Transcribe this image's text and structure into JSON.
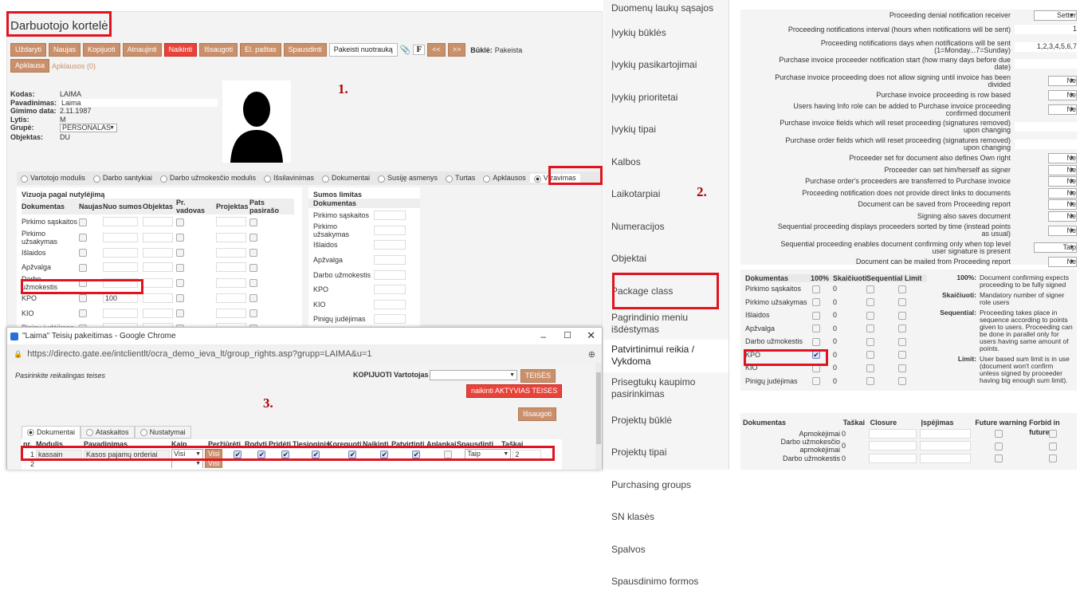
{
  "left": {
    "title": "Darbuotojo kortelė",
    "toolbar": [
      "Uždaryti",
      "Naujas",
      "Kopijuoti",
      "Atnaujinti",
      "Naikinti",
      "Išsaugoti",
      "El. paštas",
      "Spausdinti",
      "Pakeisti nuotrauką",
      "F",
      "<<",
      ">>"
    ],
    "status_label": "Būklė:",
    "status_value": "Pakeista",
    "survey_btn": "Apklausa",
    "survey_count": "Apklausos (0)",
    "fields": [
      {
        "l": "Kodas:",
        "v": "LAIMA"
      },
      {
        "l": "Pavadinimas:",
        "v": "Laima"
      },
      {
        "l": "Gimimo data:",
        "v": "2.11.1987"
      },
      {
        "l": "Lytis:",
        "v": "M"
      },
      {
        "l": "Grupė:",
        "v": "PERSONALAS"
      },
      {
        "l": "Objektas:",
        "v": "DU"
      }
    ],
    "tabs": [
      "Vartotojo modulis",
      "Darbo santykiai",
      "Darbo užmokesčio modulis",
      "Išsilavinimas",
      "Dokumentai",
      "Susiję asmenys",
      "Turtas",
      "Apklausos",
      "Vizavimas"
    ],
    "grid_title": "Vizuoja pagal nutylėjimą",
    "grid_headers": [
      "Dokumentas",
      "Naujas",
      "Nuo sumos",
      "Objektas",
      "Pr. vadovas",
      "Projektas",
      "Pats pasirašo"
    ],
    "grid_rows": [
      {
        "d": "Pirkimo sąskaitos",
        "s": ""
      },
      {
        "d": "Pirkimo užsakymas",
        "s": ""
      },
      {
        "d": "Išlaidos",
        "s": ""
      },
      {
        "d": "Apžvalga",
        "s": ""
      },
      {
        "d": "Darbo užmokestis",
        "s": ""
      },
      {
        "d": "KPO",
        "s": "100"
      },
      {
        "d": "KIO",
        "s": ""
      },
      {
        "d": "Pinigų judėjimas",
        "s": ""
      }
    ],
    "sum_title": "Sumos limitas",
    "sum_header": "Dokumentas",
    "sum_rows": [
      "Pirkimo sąskaitos",
      "Pirkimo užsakymas",
      "Išlaidos",
      "Apžvalga",
      "Darbo užmokestis",
      "KPO",
      "KIO",
      "Pinigų judėjimas"
    ]
  },
  "popup": {
    "title": "\"Laima\" Teisių pakeitimas - Google Chrome",
    "url": "https://directo.gate.ee/intclientlt/ocra_demo_ieva_lt/group_rights.asp?grupp=LAIMA&u=1",
    "label": "Pasirinkite reikalingas teises",
    "copy_label": "KOPIJUOTI Vartotojas",
    "teises": "TEISĖS",
    "delete": "naikinti AKTYVIAS TEISES",
    "save": "Išsaugoti",
    "tabs": [
      "Dokumentai",
      "Ataskaitos",
      "Nustatymai"
    ],
    "headers": [
      "nr.",
      "Modulis",
      "Pavadinimas",
      "Kaip",
      "Peržiūrėti",
      "Rodyti",
      "Pridėti",
      "Tiesioginis",
      "Koreguoti",
      "Naikinti",
      "Patvirtinti",
      "Aplankai",
      "Spausdinti",
      "Taškai"
    ],
    "row": {
      "nr": "1",
      "module": "kassain",
      "name": "Kasos pajamų orderiai",
      "kaip": "Visi",
      "visi": "Visi",
      "print": "Taip",
      "points": "2"
    },
    "row2": {
      "nr": "2",
      "visi": "Visi"
    }
  },
  "nav": [
    "Duomenų laukų sąsajos",
    "Įvykių būklės",
    "Įvykių pasikartojimai",
    "Įvykių prioritetai",
    "Įvykių tipai",
    "Kalbos",
    "Laikotarpiai",
    "Numeracijos",
    "Objektai",
    "Package class",
    "Pagrindinio meniu išdėstymas",
    "Patvirtinimui reikia / Vykdoma",
    "Prisegtukų kaupimo pasirinkimas",
    "Projektų būklė",
    "Projektų tipai",
    "Purchasing groups",
    "SN klasės",
    "Spalvos",
    "Spausdinimo formos"
  ],
  "settings": [
    {
      "l": "Proceeding denial notification receiver",
      "v": "Setter",
      "t": "sel"
    },
    {
      "l": "Proceeding notifications interval (hours when notifications will be sent)",
      "v": "1",
      "t": "inp"
    },
    {
      "l": "Proceeding notifications days when notifications will be sent (1=Monday...7=Sunday)",
      "v": "1,2,3,4,5,6,7",
      "t": "inp"
    },
    {
      "l": "Purchase invoice proceeder notification start (how many days before due date)",
      "v": "",
      "t": "inp"
    },
    {
      "l": "Purchase invoice proceeding does not allow signing until invoice has been divided",
      "v": "Ne",
      "t": "sel"
    },
    {
      "l": "Purchase invoice proceeding is row based",
      "v": "Ne",
      "t": "sel"
    },
    {
      "l": "Users having Info role can be added to Purchase invoice proceeding confirmed document",
      "v": "Ne",
      "t": "sel"
    },
    {
      "l": "Purchase invoice fields which will reset proceeding (signatures removed) upon changing",
      "v": "",
      "t": "inp"
    },
    {
      "l": "Purchase order fields which will reset proceeding (signatures removed) upon changing",
      "v": "",
      "t": "inp"
    },
    {
      "l": "Proceeder set for document also defines Own right",
      "v": "Ne",
      "t": "sel"
    },
    {
      "l": "Proceeder can set him/herself as signer",
      "v": "Ne",
      "t": "sel"
    },
    {
      "l": "Purchase order's proceeders are transferred to Purchase invoice",
      "v": "Ne",
      "t": "sel"
    },
    {
      "l": "Proceeding notification does not provide direct links to documents",
      "v": "Ne",
      "t": "sel"
    },
    {
      "l": "Document can be saved from Proceeding report",
      "v": "Ne",
      "t": "sel"
    },
    {
      "l": "Signing also saves document",
      "v": "Ne",
      "t": "sel"
    },
    {
      "l": "Sequential proceeding displays proceeders sorted by time (instead points as usual)",
      "v": "Ne",
      "t": "sel"
    },
    {
      "l": "Sequential proceeding enables document confirming only when top level user signature is present",
      "v": "Taip",
      "t": "sel"
    },
    {
      "l": "Document can be mailed from Proceeding report",
      "v": "Ne",
      "t": "sel"
    }
  ],
  "proc_headers": [
    "Dokumentas",
    "100%",
    "Skaičiuoti",
    "Sequential",
    "Limit"
  ],
  "proc_rows": [
    {
      "d": "Pirkimo sąskaitos",
      "c": false
    },
    {
      "d": "Pirkimo užsakymas",
      "c": false
    },
    {
      "d": "Išlaidos",
      "c": false
    },
    {
      "d": "Apžvalga",
      "c": false
    },
    {
      "d": "Darbo užmokestis",
      "c": false
    },
    {
      "d": "KPO",
      "c": true
    },
    {
      "d": "KIO",
      "c": false
    },
    {
      "d": "Pinigų judėjimas",
      "c": false
    }
  ],
  "proc_zero": "0",
  "legend": [
    {
      "k": "100%:",
      "v": "Document confirming expects proceeding to be fully signed"
    },
    {
      "k": "Skaičiuoti:",
      "v": "Mandatory number of signer role users"
    },
    {
      "k": "Sequential:",
      "v": "Proceeding takes place in sequence according to points given to users. Proceeding can be done in parallel only for users having same amount of points."
    },
    {
      "k": "Limit:",
      "v": "User based sum limit is in use (document won't confirm unless signed by proceeder having big enough sum limit)."
    }
  ],
  "bottom_headers": [
    "Dokumentas",
    "Taškai",
    "Closure",
    "Įspėjimas",
    "Future warning",
    "Forbid in future"
  ],
  "bottom_rows": [
    {
      "d": "Apmokėjimai",
      "p": "0"
    },
    {
      "d": "Darbo užmokesčio apmokėjimai",
      "p": "0"
    },
    {
      "d": "Darbo užmokestis",
      "p": "0"
    }
  ],
  "labels": [
    "1.",
    "2.",
    "3."
  ]
}
